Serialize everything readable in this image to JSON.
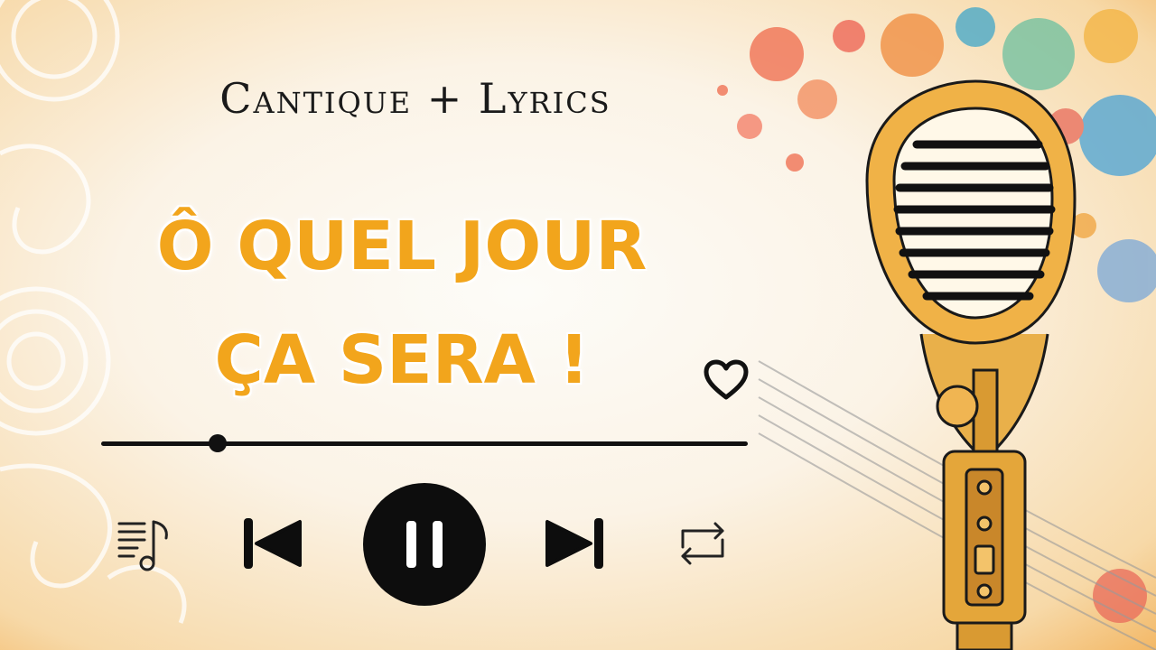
{
  "header": {
    "subtitle": "Cantique + Lyrics"
  },
  "song": {
    "title_line1": "Ô QUEL JOUR",
    "title_line2": "ÇA SERA !"
  },
  "player": {
    "progress_fraction": 0.18,
    "state": "playing",
    "liked": false,
    "icons": {
      "favorite": "heart-icon",
      "playlist": "playlist-icon",
      "previous": "skip-previous-icon",
      "pause": "pause-icon",
      "next": "skip-next-icon",
      "repeat": "repeat-icon"
    }
  },
  "colors": {
    "title": "#f2a51c",
    "controls": "#111111",
    "background_accent": "#f3b866"
  }
}
